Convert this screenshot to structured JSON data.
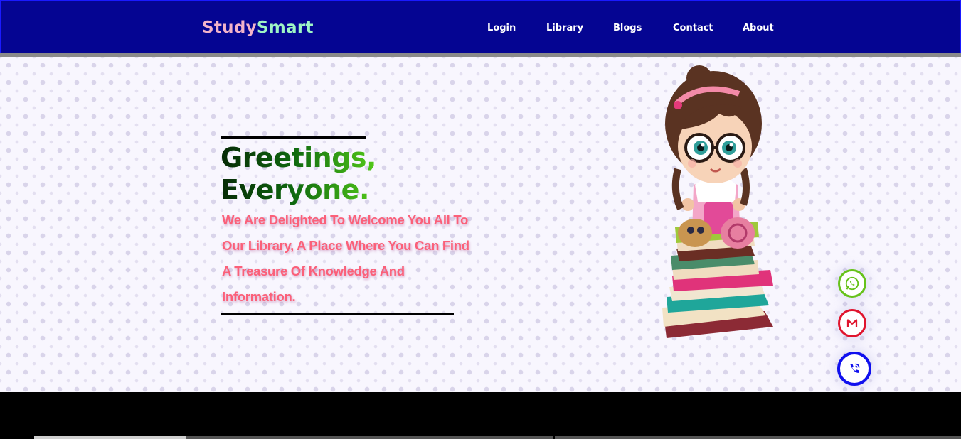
{
  "nav": {
    "logo_part1": "Study",
    "logo_part2": "Smart",
    "links": [
      "Login",
      "Library",
      "Blogs",
      "Contact",
      "About"
    ]
  },
  "hero": {
    "headline_line1": "Greetings,",
    "headline_line2": "Everyone.",
    "welcome_lines": [
      "We Are Delighted To Welcome You All To",
      "Our Library, A Place Where You Can Find",
      "A Treasure Of Knowledge And",
      "Information."
    ]
  },
  "contact_buttons": {
    "whatsapp_icon": "whatsapp-icon",
    "gmail_icon": "gmail-icon",
    "phone_icon": "phone-icon"
  },
  "colors": {
    "navbar": "#050592",
    "logo_study": "#f2b3c9",
    "logo_smart": "#9ef5c5",
    "welcome_text": "#fb6079",
    "whatsapp": "#66c21a",
    "gmail": "#e0142d",
    "phone": "#1010ee"
  }
}
